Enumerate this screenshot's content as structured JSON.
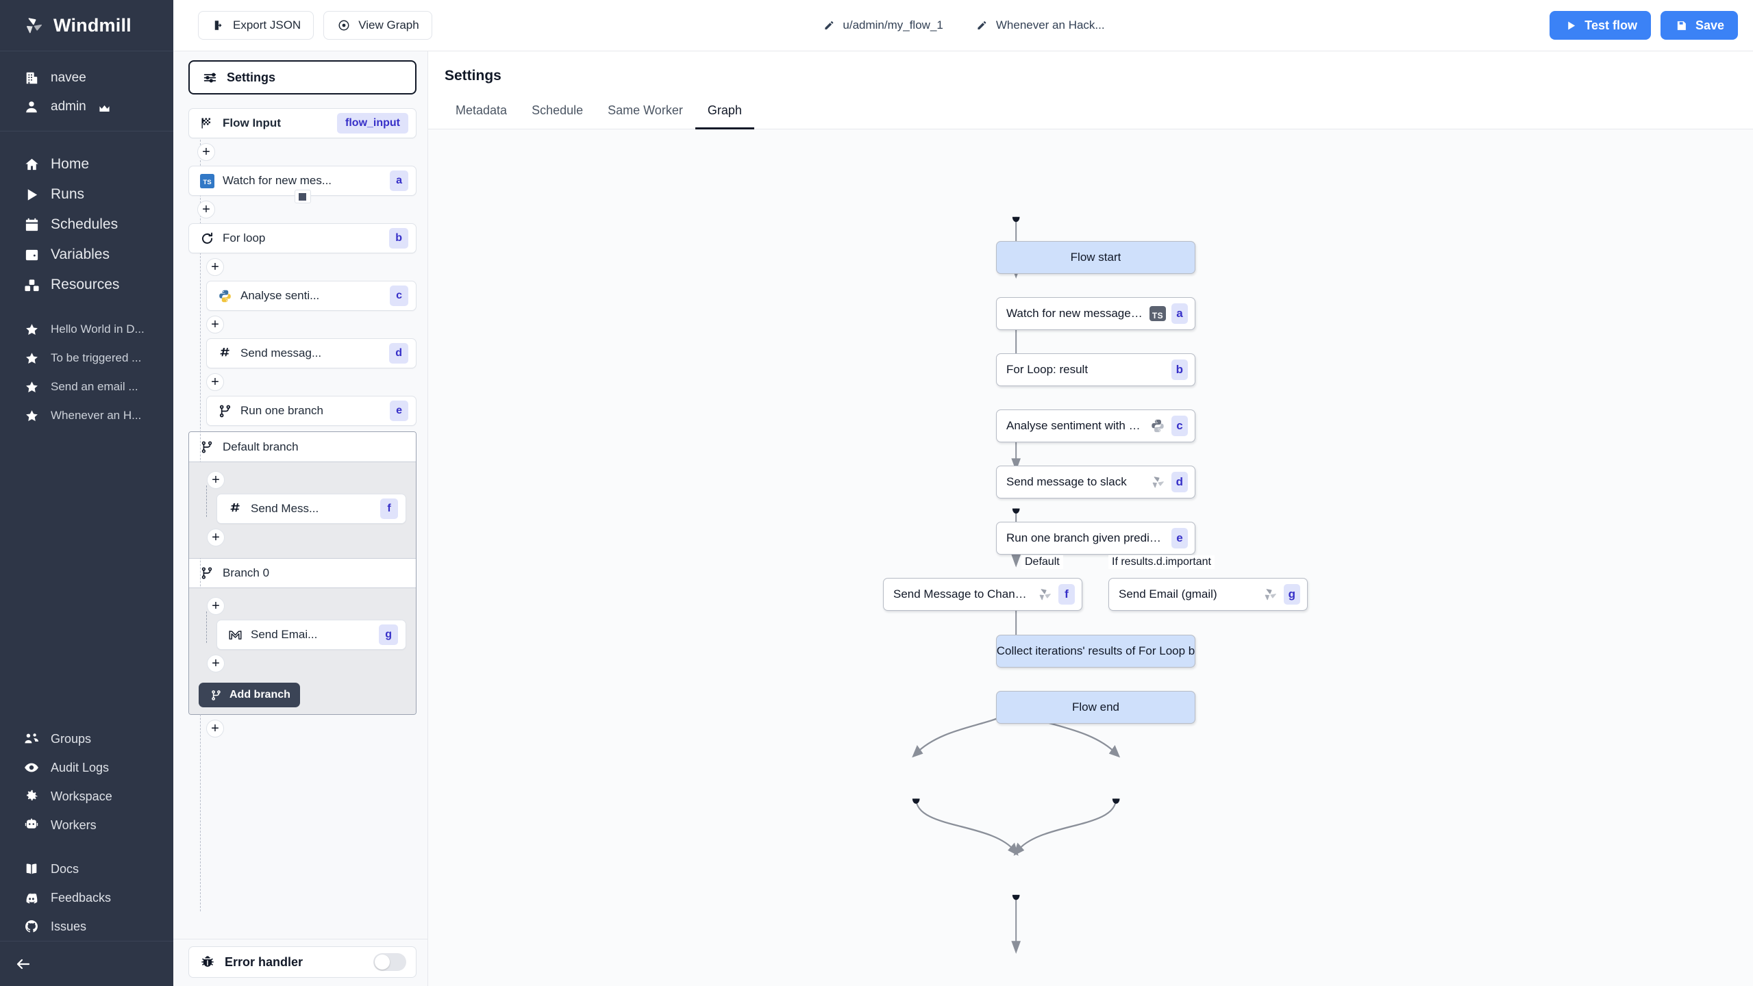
{
  "brand": {
    "name": "Windmill",
    "logo_icon": "windmill-logo-icon"
  },
  "sidebar": {
    "workspace": {
      "label": "navee",
      "icon": "building-icon"
    },
    "user": {
      "label": "admin",
      "icon": "user-icon",
      "badge_icon": "crown-icon"
    },
    "main_items": [
      {
        "label": "Home",
        "icon": "home-icon"
      },
      {
        "label": "Runs",
        "icon": "play-icon"
      },
      {
        "label": "Schedules",
        "icon": "calendar-icon"
      },
      {
        "label": "Variables",
        "icon": "wallet-icon"
      },
      {
        "label": "Resources",
        "icon": "boxes-icon"
      }
    ],
    "favorites": [
      {
        "label": "Hello World in D...",
        "icon": "star-icon"
      },
      {
        "label": "To be triggered ...",
        "icon": "star-icon"
      },
      {
        "label": "Send an email ...",
        "icon": "star-icon"
      },
      {
        "label": "Whenever an H...",
        "icon": "star-icon"
      }
    ],
    "admin_items": [
      {
        "label": "Groups",
        "icon": "groups-icon"
      },
      {
        "label": "Audit Logs",
        "icon": "eye-icon"
      },
      {
        "label": "Workspace",
        "icon": "gear-icon"
      },
      {
        "label": "Workers",
        "icon": "robot-icon"
      }
    ],
    "footer_items": [
      {
        "label": "Docs",
        "icon": "book-icon"
      },
      {
        "label": "Feedbacks",
        "icon": "discord-icon"
      },
      {
        "label": "Issues",
        "icon": "github-icon"
      }
    ],
    "collapse": {
      "icon": "arrow-left-icon"
    }
  },
  "topbar": {
    "export_json": {
      "label": "Export JSON",
      "icon": "export-icon"
    },
    "view_graph": {
      "label": "View Graph",
      "icon": "eye-circle-icon"
    },
    "flow_path": {
      "label": "u/admin/my_flow_1",
      "icon": "pencil-icon"
    },
    "flow_summary": {
      "label": "Whenever an Hack...",
      "icon": "pencil-icon"
    },
    "test_flow": {
      "label": "Test flow",
      "icon": "play-icon"
    },
    "save": {
      "label": "Save",
      "icon": "save-icon"
    }
  },
  "flow_editor": {
    "settings_button": {
      "label": "Settings",
      "icon": "sliders-icon"
    },
    "flow_input": {
      "label": "Flow Input",
      "chip": "flow_input",
      "icon": "flag-icon"
    },
    "steps": [
      {
        "label": "Watch for new mes...",
        "chip": "a",
        "icon": "typescript-icon"
      },
      {
        "label": "For loop",
        "chip": "b",
        "icon": "loop-icon"
      },
      {
        "label": "Analyse senti...",
        "chip": "c",
        "icon": "python-icon",
        "indent": true
      },
      {
        "label": "Send messag...",
        "chip": "d",
        "icon": "slack-icon",
        "indent": true
      },
      {
        "label": "Run one branch",
        "chip": "e",
        "icon": "branch-icon",
        "indent": true
      }
    ],
    "branches": [
      {
        "header": {
          "label": "Default branch",
          "icon": "branch-icon"
        },
        "step": {
          "label": "Send Mess...",
          "chip": "f",
          "icon": "slack-icon"
        }
      },
      {
        "header": {
          "label": "Branch 0",
          "icon": "branch-icon"
        },
        "step": {
          "label": "Send Emai...",
          "chip": "g",
          "icon": "gmail-icon"
        }
      }
    ],
    "add_branch": {
      "label": "Add branch",
      "icon": "branch-icon"
    },
    "error_handler": {
      "label": "Error handler",
      "icon": "bug-icon",
      "enabled": false
    }
  },
  "panel": {
    "title": "Settings",
    "tabs": [
      {
        "label": "Metadata",
        "active": false
      },
      {
        "label": "Schedule",
        "active": false
      },
      {
        "label": "Same Worker",
        "active": false
      },
      {
        "label": "Graph",
        "active": true
      }
    ]
  },
  "graph": {
    "nodes": [
      {
        "id": "start",
        "label": "Flow start",
        "kind": "blue"
      },
      {
        "id": "a",
        "label": "Watch for new message with mentio...",
        "chip": "a",
        "icon": "typescript-icon"
      },
      {
        "id": "b",
        "label": "For Loop: result",
        "chip": "b",
        "icon": "none"
      },
      {
        "id": "c",
        "label": "Analyse sentiment with nltk",
        "chip": "c",
        "icon": "python-icon"
      },
      {
        "id": "d",
        "label": "Send message to slack",
        "chip": "d",
        "icon": "windmill-icon"
      },
      {
        "id": "e",
        "label": "Run one branch given predicate",
        "chip": "e",
        "icon": "none"
      },
      {
        "id": "f",
        "label": "Send Message to Channel (slack)",
        "chip": "f",
        "icon": "windmill-icon"
      },
      {
        "id": "g",
        "label": "Send Email (gmail)",
        "chip": "g",
        "icon": "windmill-icon"
      },
      {
        "id": "collect",
        "label": "Collect iterations' results of For Loop b",
        "kind": "blue"
      },
      {
        "id": "end",
        "label": "Flow end",
        "kind": "blue"
      }
    ],
    "edge_labels": [
      {
        "label": "Default"
      },
      {
        "label": "If results.d.important"
      }
    ]
  },
  "colors": {
    "sidebar_bg": "#2e3647",
    "primary": "#3b82f6",
    "chip_bg": "#e0e3fb",
    "chip_fg": "#3730c8",
    "node_blue": "#cfe0fb"
  }
}
